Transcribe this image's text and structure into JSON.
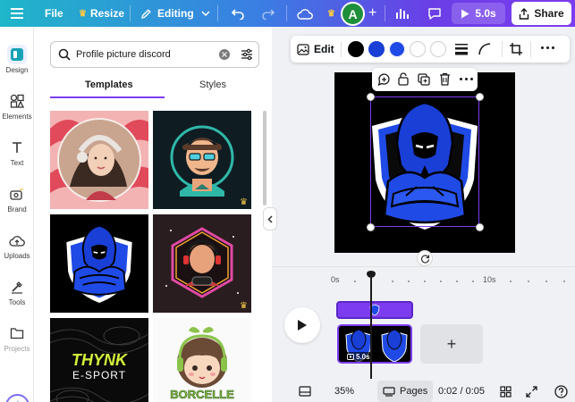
{
  "topbar": {
    "file_label": "File",
    "resize_label": "Resize",
    "editing_label": "Editing",
    "avatar_initial": "A",
    "duration_label": "5.0s",
    "share_label": "Share"
  },
  "rail": {
    "items": [
      {
        "label": "Design",
        "icon": "design-icon"
      },
      {
        "label": "Elements",
        "icon": "elements-icon"
      },
      {
        "label": "Text",
        "icon": "text-icon"
      },
      {
        "label": "Brand",
        "icon": "brand-icon"
      },
      {
        "label": "Uploads",
        "icon": "uploads-icon"
      },
      {
        "label": "Tools",
        "icon": "tools-icon"
      },
      {
        "label": "Projects",
        "icon": "projects-icon"
      }
    ]
  },
  "panel": {
    "search_value": "Profile picture discord",
    "tabs": [
      {
        "label": "Templates"
      },
      {
        "label": "Styles"
      }
    ],
    "templates": [
      {
        "text": ""
      },
      {
        "text": ""
      },
      {
        "text": ""
      },
      {
        "text": ""
      },
      {
        "line1": "THYNK",
        "line2": "E-SPORT"
      },
      {
        "line1": "BORCELLE"
      }
    ]
  },
  "editbar": {
    "edit_label": "Edit",
    "colors": [
      "#000000",
      "#1a3fd6",
      "#1f4ae6",
      "#ffffff",
      "#ffffff"
    ]
  },
  "timeline": {
    "ruler": [
      "0s",
      "10s"
    ],
    "clip_duration": "5.0s"
  },
  "bottom": {
    "zoom": "35%",
    "pages_label": "Pages",
    "time": "0:02 / 0:05"
  },
  "colors": {
    "accent": "#7d3cf0",
    "crown": "#f5c84a",
    "mascot_blue": "#1f4ae6"
  }
}
